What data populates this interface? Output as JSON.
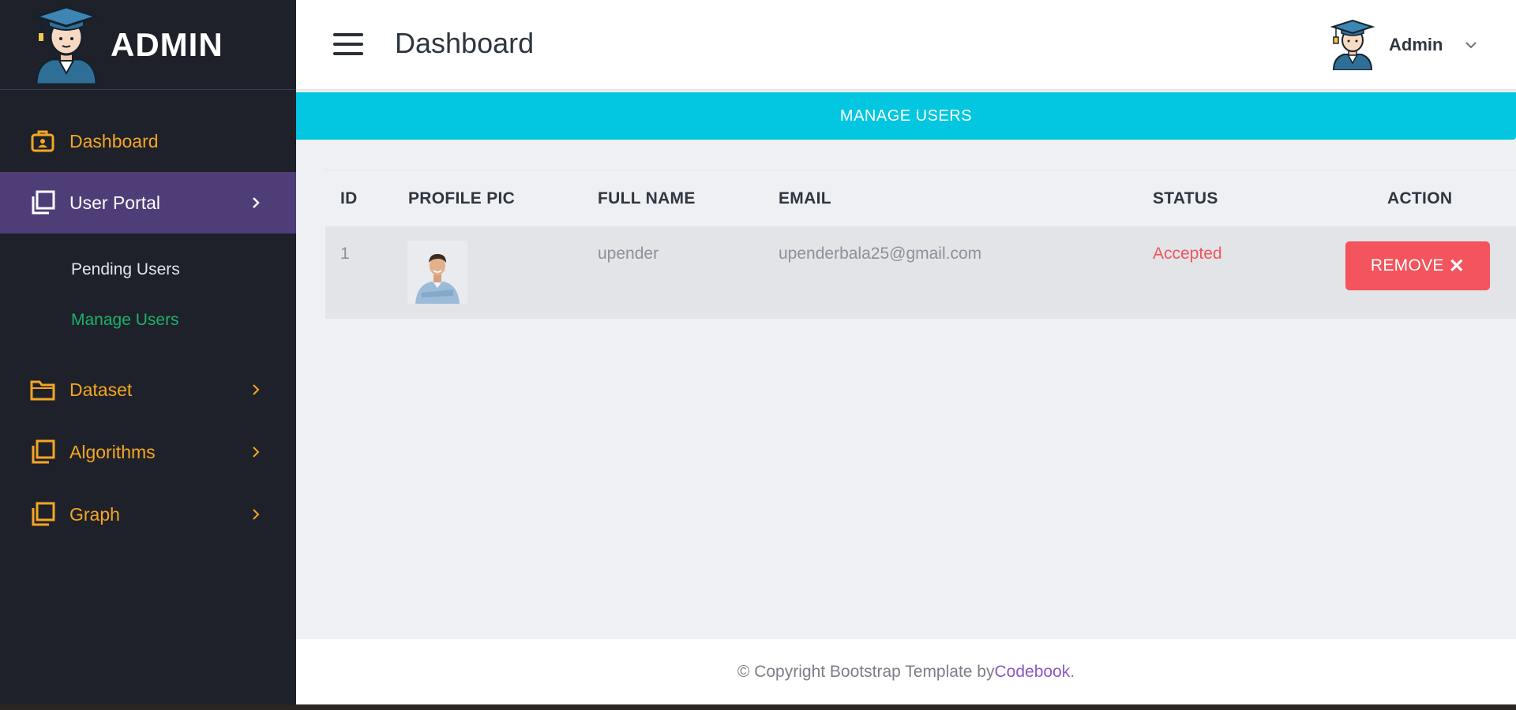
{
  "brand": {
    "title": "ADMIN"
  },
  "sidebar": {
    "items": [
      {
        "label": "Dashboard",
        "icon": "briefcase-user-icon"
      },
      {
        "label": "User Portal",
        "icon": "copy-icon"
      },
      {
        "label": "Dataset",
        "icon": "folder-icon"
      },
      {
        "label": "Algorithms",
        "icon": "copy-icon"
      },
      {
        "label": "Graph",
        "icon": "copy-icon"
      }
    ],
    "subitems": [
      {
        "label": "Pending Users"
      },
      {
        "label": "Manage Users"
      }
    ]
  },
  "header": {
    "title": "Dashboard",
    "user_name": "Admin"
  },
  "banner": {
    "label": "MANAGE USERS"
  },
  "table": {
    "columns": [
      "ID",
      "PROFILE PIC",
      "FULL NAME",
      "EMAIL",
      "STATUS",
      "ACTION"
    ],
    "rows": [
      {
        "id": "1",
        "full_name": "upender",
        "email": "upenderbala25@gmail.com",
        "status": "Accepted",
        "action_label": "REMOVE",
        "action_icon": "✕"
      }
    ]
  },
  "footer": {
    "prefix": "© Copyright Bootstrap Template by ",
    "link": "Codebook",
    "suffix": "."
  },
  "colors": {
    "sidebar_bg": "#1e212a",
    "accent_orange": "#f5a623",
    "active_purple": "#4f3d78",
    "submenu_active": "#1ab26b",
    "banner_cyan": "#03c6e1",
    "danger": "#f3545d",
    "link_purple": "#8a57c8"
  }
}
